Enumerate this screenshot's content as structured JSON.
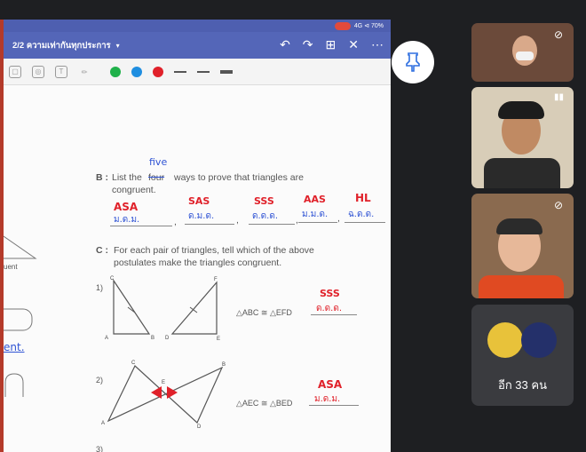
{
  "shared_screen": {
    "app_title": "2/2 ความเท่ากันทุกประการ",
    "title_caret": "▾",
    "status": "4G ⊲ 70%",
    "actions": [
      "undo-icon",
      "redo-icon",
      "add-page-icon",
      "close-icon",
      "more-icon"
    ],
    "pen_colors": [
      "#20b14a",
      "#1f8ee0",
      "#e0212a"
    ],
    "worksheet": {
      "question_b_label": "B :",
      "question_b_text_1": "List the",
      "struck_word": "four",
      "correction_word": "five",
      "question_b_text_2": "ways to prove that triangles are",
      "question_b_text_3": "congruent.",
      "answers_b": [
        {
          "abbr": "ASA",
          "thai": "ม.ด.ม."
        },
        {
          "abbr": "SAS",
          "thai": "ด.ม.ด."
        },
        {
          "abbr": "SSS",
          "thai": "ด.ด.ด."
        },
        {
          "abbr": "AAS",
          "thai": "ม.ม.ด."
        },
        {
          "abbr": "HL",
          "thai": "ฉ.ด.ด."
        }
      ],
      "question_c_label": "C :",
      "question_c_text_1": "For each pair of triangles, tell which of the above",
      "question_c_text_2": "postulates make the triangles congruent.",
      "items": [
        {
          "number": "1)",
          "statement": "△ABC ≅ △EFD",
          "abbr": "SSS",
          "thai": "ด.ด.ด."
        },
        {
          "number": "2)",
          "statement": "△AEC ≅ △BED",
          "abbr": "ASA",
          "thai": "ม.ด.ม."
        },
        {
          "number": "3)"
        }
      ],
      "left_edge_text_1": "uent",
      "left_edge_text_2": "ent.",
      "vertex_labels_1": [
        "C",
        "F",
        "A",
        "B",
        "D",
        "E"
      ],
      "vertex_labels_2": [
        "C",
        "B",
        "E",
        "A",
        "D"
      ]
    }
  },
  "participants": {
    "pin_icon": "pin-icon",
    "tiles": [
      {
        "name": "participant-1",
        "bg": "#6b4a3a",
        "muted": true
      },
      {
        "name": "participant-2",
        "bg": "#c9b8a0",
        "muted": false
      },
      {
        "name": "participant-3",
        "bg": "#8a6a4f",
        "muted": true
      }
    ],
    "others_label": "อีก 33 คน"
  }
}
